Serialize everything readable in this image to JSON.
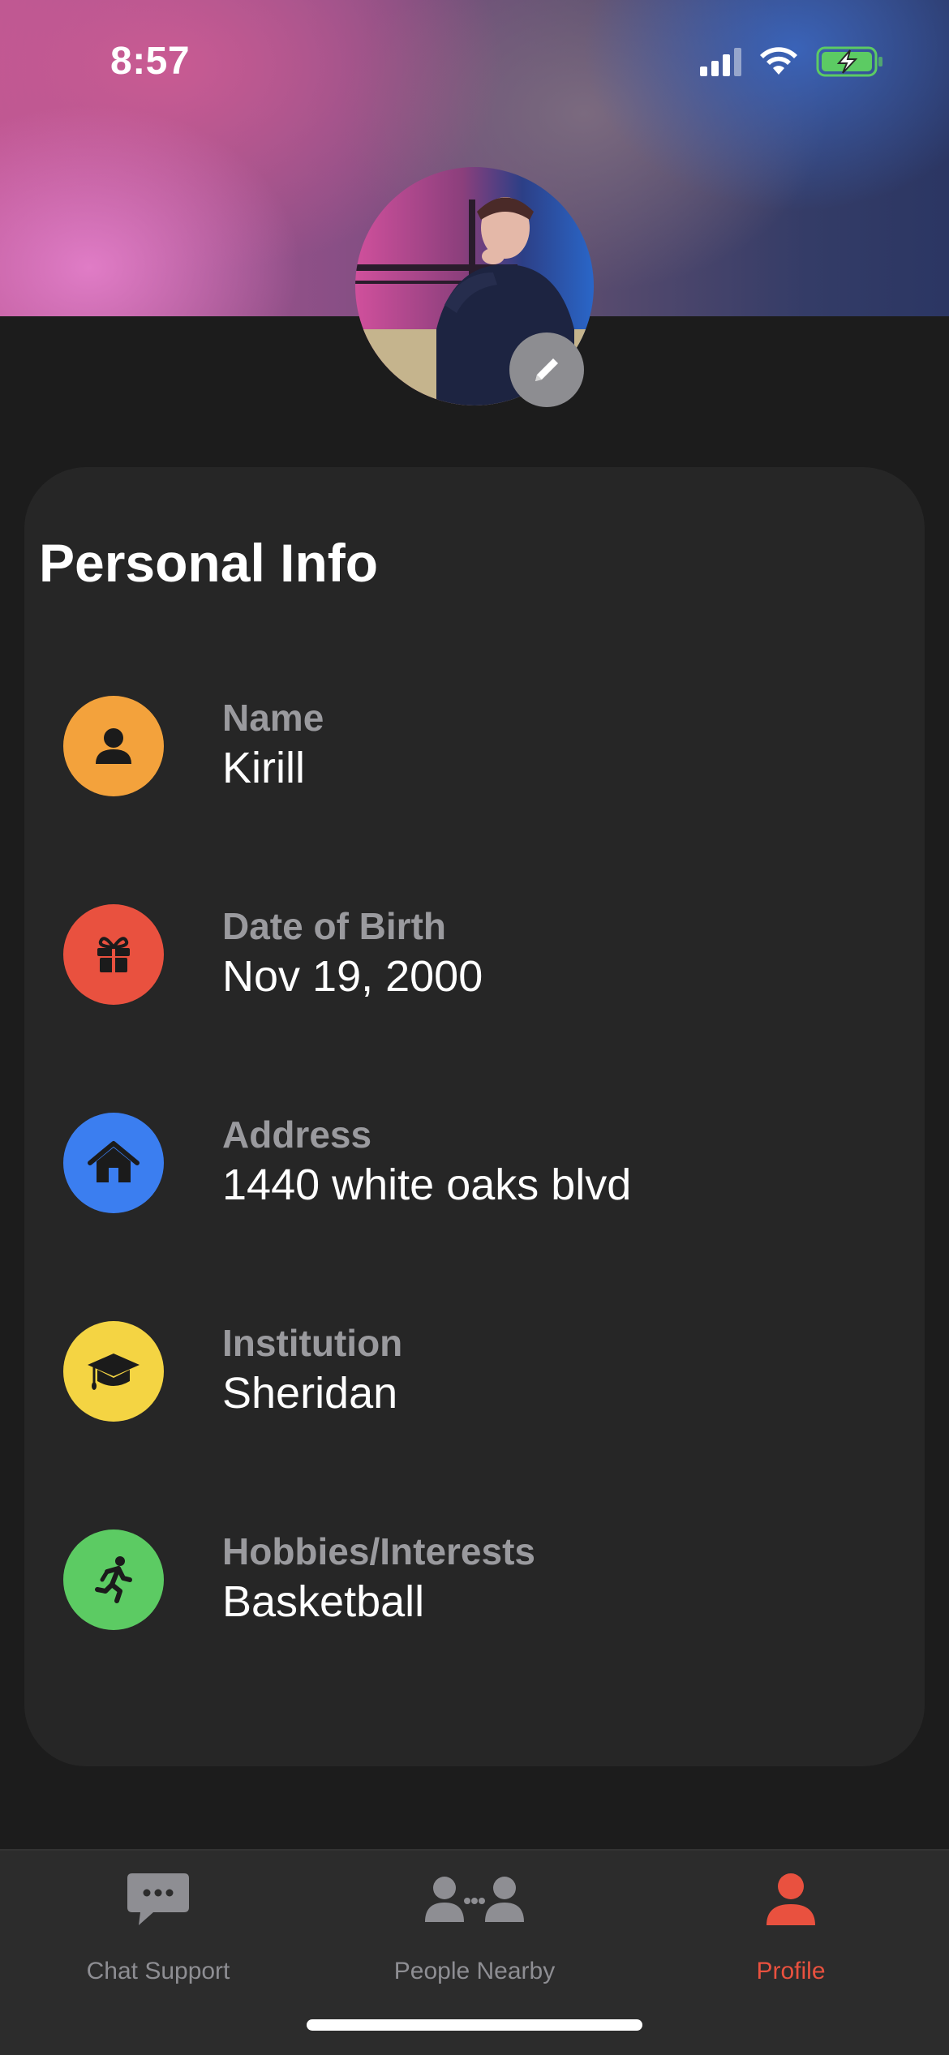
{
  "status_bar": {
    "time": "8:57",
    "icons": [
      "cellular-signal-icon",
      "wifi-icon",
      "battery-charging-icon"
    ]
  },
  "profile": {
    "avatar_alt": "profile-photo",
    "edit_icon": "pencil-icon"
  },
  "personal_info": {
    "title": "Personal Info",
    "items": [
      {
        "label": "Name",
        "value": "Kirill",
        "icon": "person-icon",
        "color": "#f3a23c"
      },
      {
        "label": "Date of Birth",
        "value": "Nov 19, 2000",
        "icon": "gift-icon",
        "color": "#e9513f"
      },
      {
        "label": "Address",
        "value": "1440 white oaks blvd",
        "icon": "house-icon",
        "color": "#3b7ef0"
      },
      {
        "label": "Institution",
        "value": "Sheridan",
        "icon": "graduation-cap-icon",
        "color": "#f4d443"
      },
      {
        "label": "Hobbies/Interests",
        "value": "Basketball",
        "icon": "running-person-icon",
        "color": "#5ccb63"
      }
    ]
  },
  "tab_bar": {
    "tabs": [
      {
        "label": "Chat Support",
        "icon": "chat-bubble-icon",
        "active": false
      },
      {
        "label": "People Nearby",
        "icon": "people-nearby-icon",
        "active": false
      },
      {
        "label": "Profile",
        "icon": "person-icon",
        "active": true
      }
    ],
    "active_color": "#e9513f",
    "inactive_color": "#8e8e93"
  }
}
